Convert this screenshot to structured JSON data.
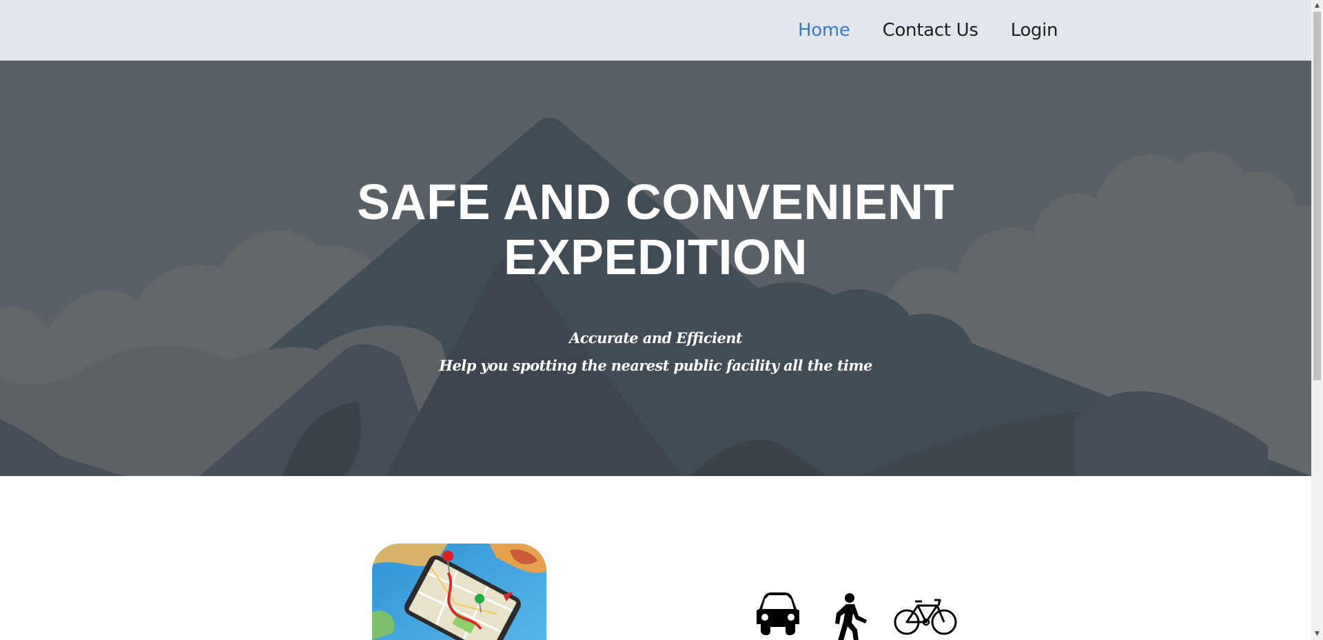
{
  "nav": {
    "items": [
      {
        "label": "Home",
        "active": true
      },
      {
        "label": "Contact Us",
        "active": false
      },
      {
        "label": "Login",
        "active": false
      }
    ],
    "active_color": "#3a7cc4",
    "background": "#e2e6ed"
  },
  "hero": {
    "title_line1": "SAFE AND CONVENIENT",
    "title_line2": "EXPEDITION",
    "subtitle1": "Accurate and Efficient",
    "subtitle2": "Help you spotting the nearest public facility all the time",
    "background_color": "#5a6166"
  },
  "features": {
    "app_image": "map-navigation-phone-image",
    "transport_icons": [
      "car-icon",
      "walking-person-icon",
      "bicycle-icon"
    ]
  }
}
